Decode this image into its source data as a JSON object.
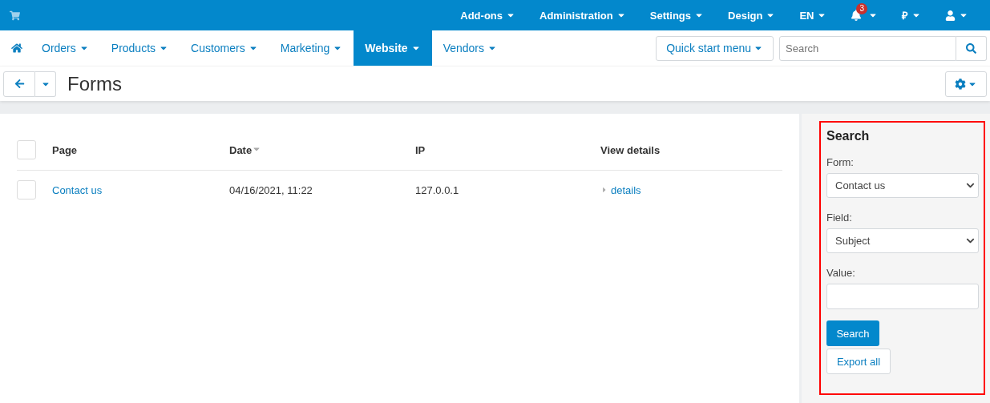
{
  "top_menu": [
    {
      "label": "Add-ons"
    },
    {
      "label": "Administration"
    },
    {
      "label": "Settings"
    },
    {
      "label": "Design"
    },
    {
      "label": "EN"
    }
  ],
  "notifications": {
    "badge": "3"
  },
  "currency": {
    "symbol": "₽"
  },
  "nav_tabs": [
    {
      "label": "Orders",
      "selected": false
    },
    {
      "label": "Products",
      "selected": false
    },
    {
      "label": "Customers",
      "selected": false
    },
    {
      "label": "Marketing",
      "selected": false
    },
    {
      "label": "Website",
      "selected": true
    },
    {
      "label": "Vendors",
      "selected": false
    }
  ],
  "quick_start": "Quick start menu",
  "search": {
    "placeholder": "Search"
  },
  "page_title": "Forms",
  "table": {
    "select_all_checked": false,
    "columns": [
      {
        "label": "Page",
        "sorted": false
      },
      {
        "label": "Date",
        "sorted": true
      },
      {
        "label": "IP",
        "sorted": false
      },
      {
        "label": "View details",
        "sorted": false
      }
    ],
    "rows": [
      {
        "checked": false,
        "page": "Contact us",
        "date": "04/16/2021, 11:22",
        "ip": "127.0.0.1",
        "details": "details"
      }
    ]
  },
  "sidebar": {
    "title": "Search",
    "highlighted": true,
    "fields": [
      {
        "kind": "select",
        "label": "Form:",
        "value": "Contact us"
      },
      {
        "kind": "select",
        "label": "Field:",
        "value": "Subject"
      },
      {
        "kind": "text",
        "label": "Value:"
      }
    ],
    "search_button": "Search",
    "export_button": "Export all"
  }
}
